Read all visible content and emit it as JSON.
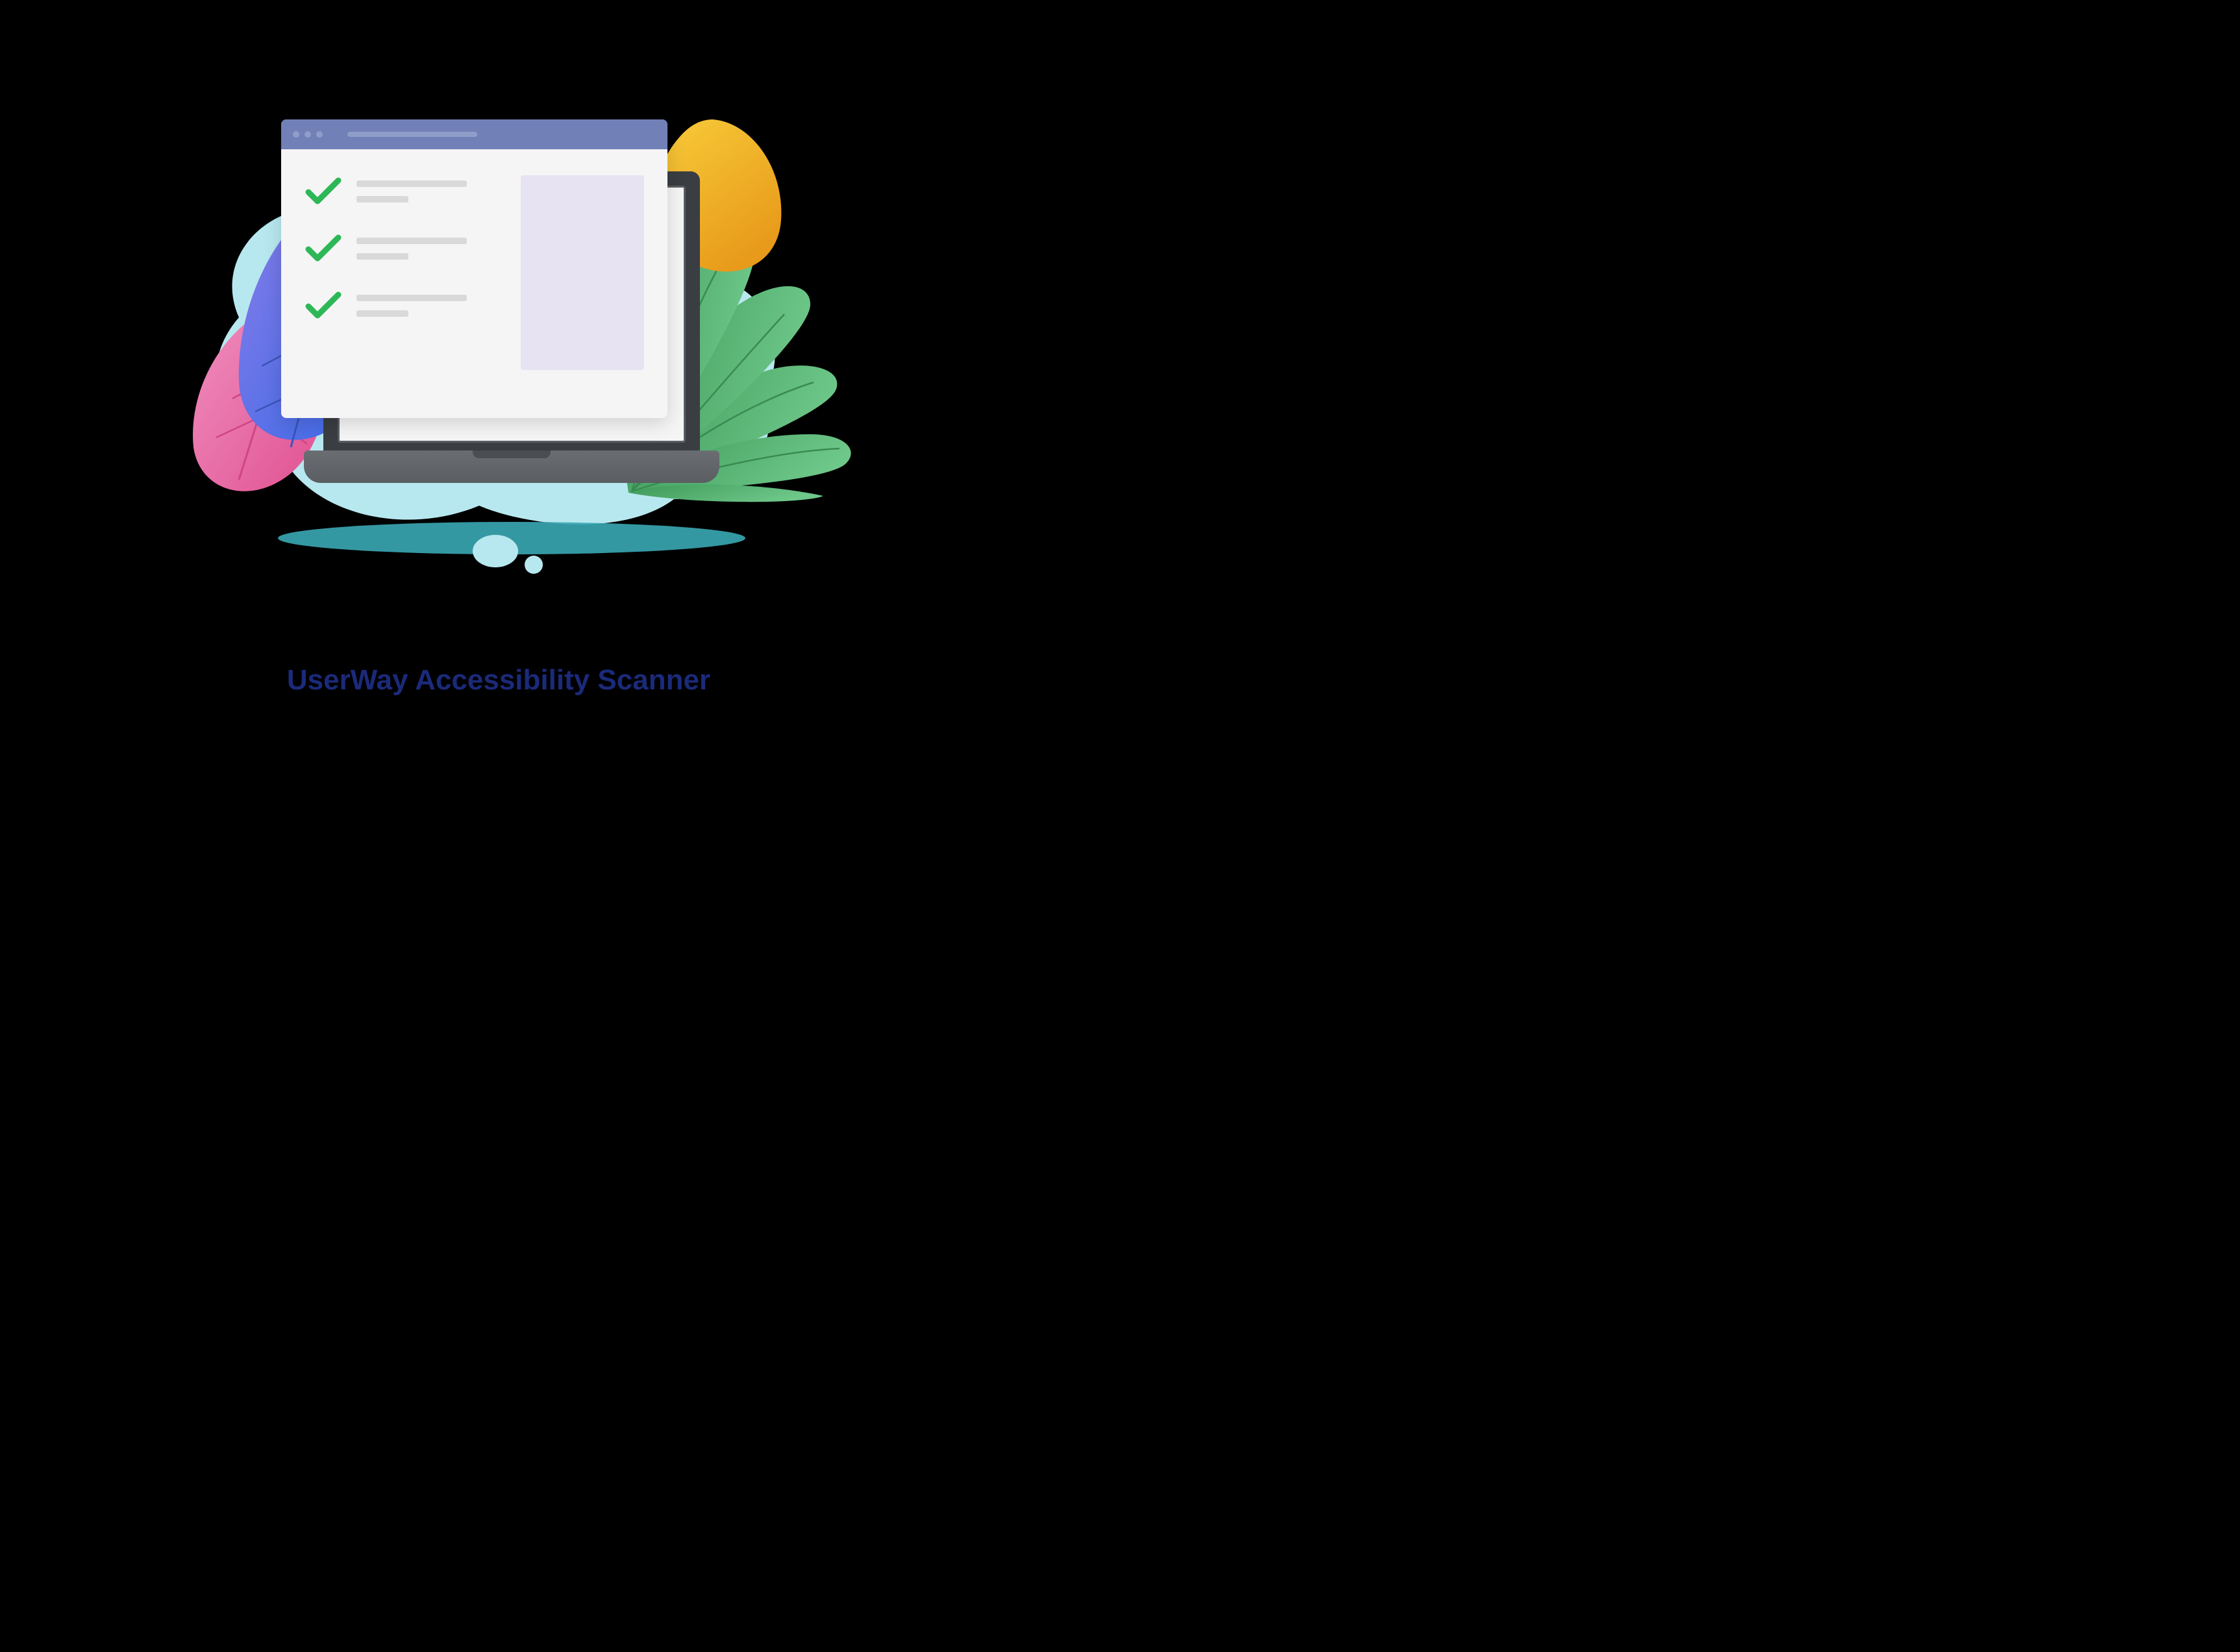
{
  "title": "UserWay Accessibility Scanner",
  "colors": {
    "title_text": "#1b2a7a",
    "cloud": "#b8e8ef",
    "cloud_dark": "#3aa9b5",
    "browser_header": "#7181b8",
    "checkmark": "#2db757",
    "panel": "#e8e3f2",
    "leaf_green": "#4aa868",
    "leaf_yellow": "#f5b82e",
    "leaf_pink": "#e86aa6",
    "leaf_purple": "#5b6fd8"
  },
  "checklist_items": 3
}
